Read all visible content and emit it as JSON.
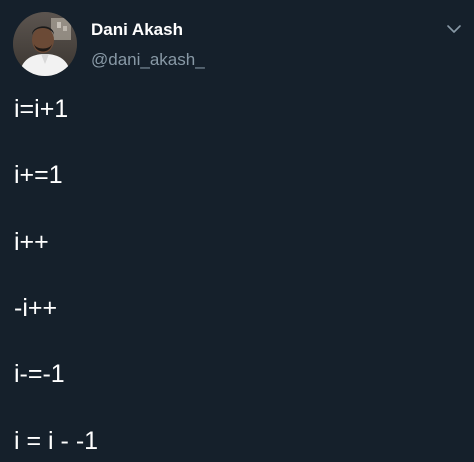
{
  "tweet": {
    "author": {
      "display_name": "Dani Akash",
      "handle": "@dani_akash_"
    },
    "menu_icon": "chevron-down-icon",
    "lines": [
      "i=i+1",
      "i+=1",
      "i++",
      "-i++",
      "i-=-1",
      "i = i - -1"
    ]
  },
  "colors": {
    "background": "#15202b",
    "text_primary": "#ffffff",
    "text_secondary": "#8899a6"
  }
}
